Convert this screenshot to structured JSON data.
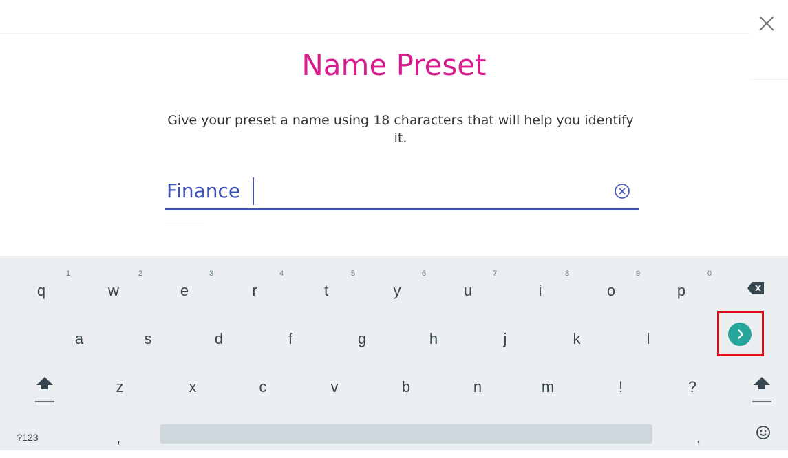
{
  "dialog": {
    "title": "Name Preset",
    "description": "Give your preset a name using 18 characters that will help you identify it.",
    "input_value": "Finance",
    "close_icon": "close-icon",
    "clear_icon": "clear-circle-icon",
    "title_color": "#d81b8c",
    "input_color": "#3f51b5"
  },
  "keyboard": {
    "row1": [
      {
        "key": "q",
        "hint": "1"
      },
      {
        "key": "w",
        "hint": "2"
      },
      {
        "key": "e",
        "hint": "3"
      },
      {
        "key": "r",
        "hint": "4"
      },
      {
        "key": "t",
        "hint": "5"
      },
      {
        "key": "y",
        "hint": "6"
      },
      {
        "key": "u",
        "hint": "7"
      },
      {
        "key": "i",
        "hint": "8"
      },
      {
        "key": "o",
        "hint": "9"
      },
      {
        "key": "p",
        "hint": "0"
      }
    ],
    "row2": [
      "a",
      "s",
      "d",
      "f",
      "g",
      "h",
      "j",
      "k",
      "l"
    ],
    "row3": [
      "z",
      "x",
      "c",
      "v",
      "b",
      "n",
      "m",
      "!",
      "?"
    ],
    "symbols_label": "?123",
    "comma": ",",
    "period": ".",
    "backspace_icon": "backspace-icon",
    "go_icon": "go-arrow-icon",
    "shift_icon": "shift-icon",
    "emoji_icon": "emoji-icon",
    "go_color": "#26a69a",
    "highlight_color": "#e0101b"
  }
}
